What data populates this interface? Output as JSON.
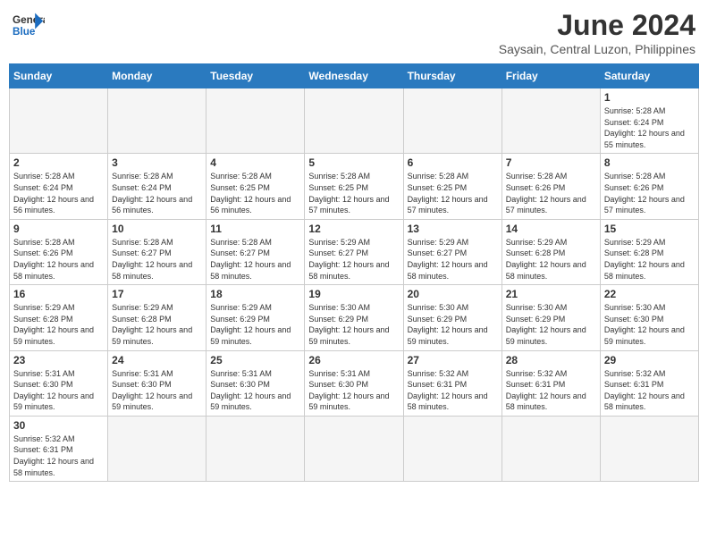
{
  "header": {
    "logo_general": "General",
    "logo_blue": "Blue",
    "title": "June 2024",
    "subtitle": "Saysain, Central Luzon, Philippines"
  },
  "days_of_week": [
    "Sunday",
    "Monday",
    "Tuesday",
    "Wednesday",
    "Thursday",
    "Friday",
    "Saturday"
  ],
  "weeks": [
    {
      "days": [
        {
          "date": "",
          "info": ""
        },
        {
          "date": "",
          "info": ""
        },
        {
          "date": "",
          "info": ""
        },
        {
          "date": "",
          "info": ""
        },
        {
          "date": "",
          "info": ""
        },
        {
          "date": "",
          "info": ""
        },
        {
          "date": "1",
          "info": "Sunrise: 5:28 AM\nSunset: 6:24 PM\nDaylight: 12 hours and 55 minutes."
        }
      ]
    },
    {
      "days": [
        {
          "date": "2",
          "info": "Sunrise: 5:28 AM\nSunset: 6:24 PM\nDaylight: 12 hours and 56 minutes."
        },
        {
          "date": "3",
          "info": "Sunrise: 5:28 AM\nSunset: 6:24 PM\nDaylight: 12 hours and 56 minutes."
        },
        {
          "date": "4",
          "info": "Sunrise: 5:28 AM\nSunset: 6:25 PM\nDaylight: 12 hours and 56 minutes."
        },
        {
          "date": "5",
          "info": "Sunrise: 5:28 AM\nSunset: 6:25 PM\nDaylight: 12 hours and 57 minutes."
        },
        {
          "date": "6",
          "info": "Sunrise: 5:28 AM\nSunset: 6:25 PM\nDaylight: 12 hours and 57 minutes."
        },
        {
          "date": "7",
          "info": "Sunrise: 5:28 AM\nSunset: 6:26 PM\nDaylight: 12 hours and 57 minutes."
        },
        {
          "date": "8",
          "info": "Sunrise: 5:28 AM\nSunset: 6:26 PM\nDaylight: 12 hours and 57 minutes."
        }
      ]
    },
    {
      "days": [
        {
          "date": "9",
          "info": "Sunrise: 5:28 AM\nSunset: 6:26 PM\nDaylight: 12 hours and 58 minutes."
        },
        {
          "date": "10",
          "info": "Sunrise: 5:28 AM\nSunset: 6:27 PM\nDaylight: 12 hours and 58 minutes."
        },
        {
          "date": "11",
          "info": "Sunrise: 5:28 AM\nSunset: 6:27 PM\nDaylight: 12 hours and 58 minutes."
        },
        {
          "date": "12",
          "info": "Sunrise: 5:29 AM\nSunset: 6:27 PM\nDaylight: 12 hours and 58 minutes."
        },
        {
          "date": "13",
          "info": "Sunrise: 5:29 AM\nSunset: 6:27 PM\nDaylight: 12 hours and 58 minutes."
        },
        {
          "date": "14",
          "info": "Sunrise: 5:29 AM\nSunset: 6:28 PM\nDaylight: 12 hours and 58 minutes."
        },
        {
          "date": "15",
          "info": "Sunrise: 5:29 AM\nSunset: 6:28 PM\nDaylight: 12 hours and 58 minutes."
        }
      ]
    },
    {
      "days": [
        {
          "date": "16",
          "info": "Sunrise: 5:29 AM\nSunset: 6:28 PM\nDaylight: 12 hours and 59 minutes."
        },
        {
          "date": "17",
          "info": "Sunrise: 5:29 AM\nSunset: 6:28 PM\nDaylight: 12 hours and 59 minutes."
        },
        {
          "date": "18",
          "info": "Sunrise: 5:29 AM\nSunset: 6:29 PM\nDaylight: 12 hours and 59 minutes."
        },
        {
          "date": "19",
          "info": "Sunrise: 5:30 AM\nSunset: 6:29 PM\nDaylight: 12 hours and 59 minutes."
        },
        {
          "date": "20",
          "info": "Sunrise: 5:30 AM\nSunset: 6:29 PM\nDaylight: 12 hours and 59 minutes."
        },
        {
          "date": "21",
          "info": "Sunrise: 5:30 AM\nSunset: 6:29 PM\nDaylight: 12 hours and 59 minutes."
        },
        {
          "date": "22",
          "info": "Sunrise: 5:30 AM\nSunset: 6:30 PM\nDaylight: 12 hours and 59 minutes."
        }
      ]
    },
    {
      "days": [
        {
          "date": "23",
          "info": "Sunrise: 5:31 AM\nSunset: 6:30 PM\nDaylight: 12 hours and 59 minutes."
        },
        {
          "date": "24",
          "info": "Sunrise: 5:31 AM\nSunset: 6:30 PM\nDaylight: 12 hours and 59 minutes."
        },
        {
          "date": "25",
          "info": "Sunrise: 5:31 AM\nSunset: 6:30 PM\nDaylight: 12 hours and 59 minutes."
        },
        {
          "date": "26",
          "info": "Sunrise: 5:31 AM\nSunset: 6:30 PM\nDaylight: 12 hours and 59 minutes."
        },
        {
          "date": "27",
          "info": "Sunrise: 5:32 AM\nSunset: 6:31 PM\nDaylight: 12 hours and 58 minutes."
        },
        {
          "date": "28",
          "info": "Sunrise: 5:32 AM\nSunset: 6:31 PM\nDaylight: 12 hours and 58 minutes."
        },
        {
          "date": "29",
          "info": "Sunrise: 5:32 AM\nSunset: 6:31 PM\nDaylight: 12 hours and 58 minutes."
        }
      ]
    },
    {
      "days": [
        {
          "date": "30",
          "info": "Sunrise: 5:32 AM\nSunset: 6:31 PM\nDaylight: 12 hours and 58 minutes."
        },
        {
          "date": "",
          "info": ""
        },
        {
          "date": "",
          "info": ""
        },
        {
          "date": "",
          "info": ""
        },
        {
          "date": "",
          "info": ""
        },
        {
          "date": "",
          "info": ""
        },
        {
          "date": "",
          "info": ""
        }
      ]
    }
  ]
}
